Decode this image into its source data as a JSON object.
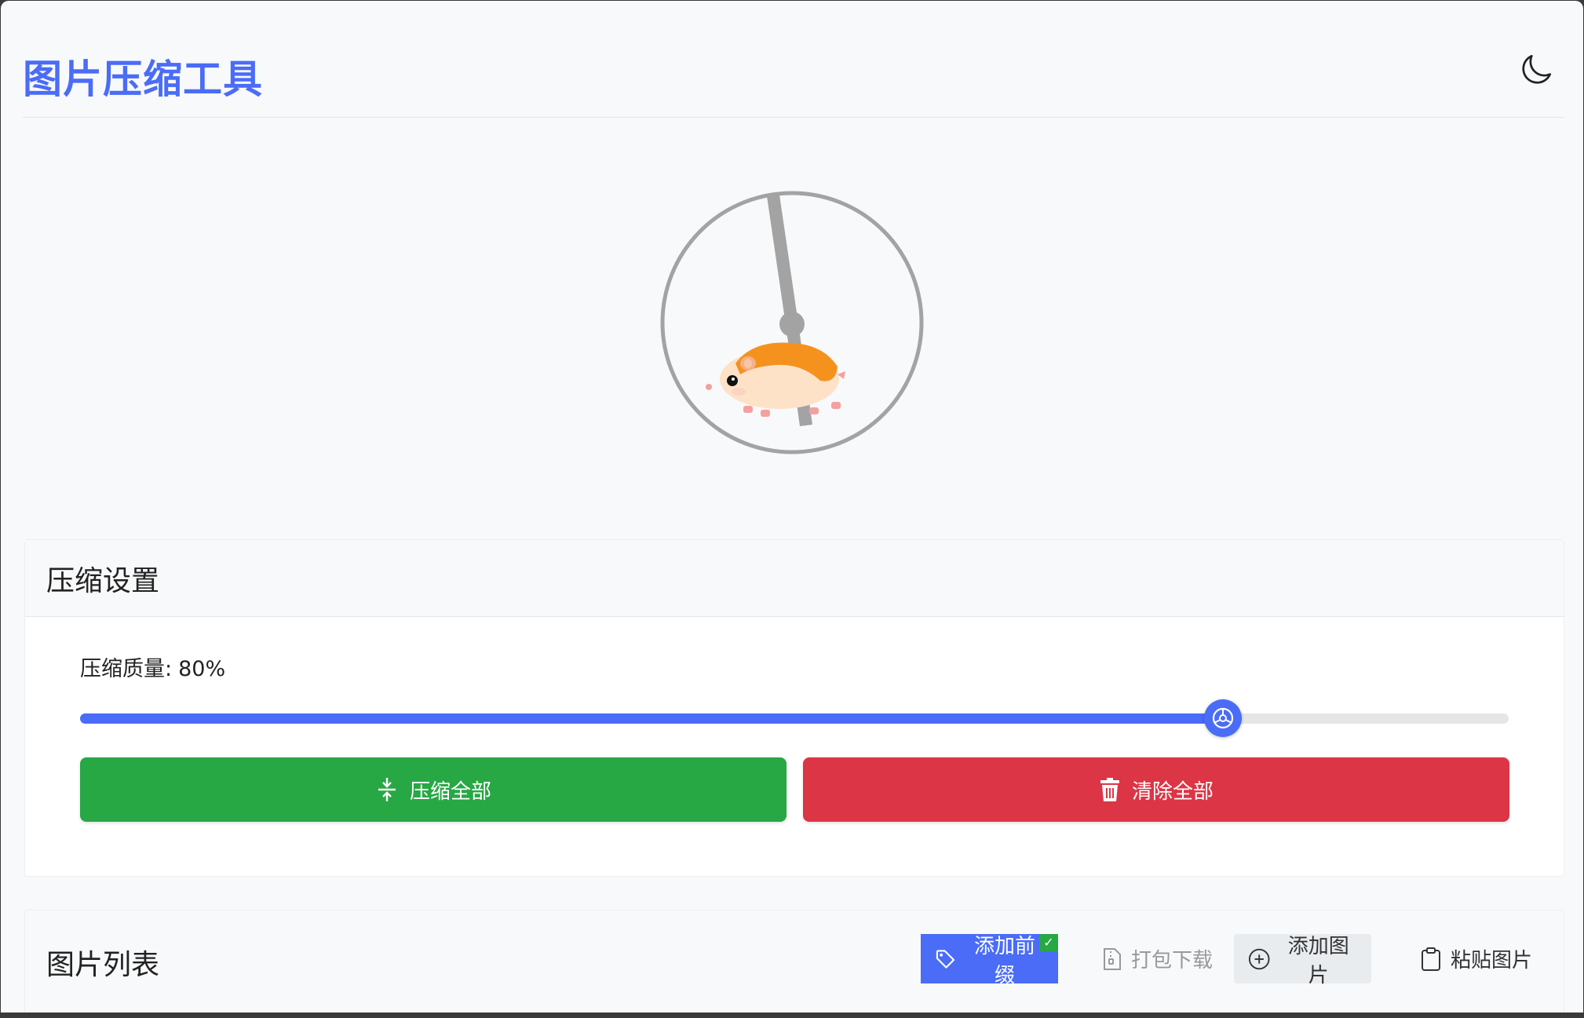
{
  "app": {
    "title": "图片压缩工具"
  },
  "header": {
    "theme_toggle_icon": "moon-icon"
  },
  "loader": {
    "icon": "hamster-wheel"
  },
  "settings": {
    "title": "压缩设置",
    "quality_label": "压缩质量:",
    "quality_value": "80%",
    "quality_percent": 80,
    "slider_thumb_icon": "hamster-ball-icon",
    "compress_all_label": "压缩全部",
    "compress_all_icon": "compress-icon",
    "clear_all_label": "清除全部",
    "clear_all_icon": "trash-icon"
  },
  "image_list": {
    "title": "图片列表",
    "add_prefix_label": "添加前缀",
    "add_prefix_icon": "tag-icon",
    "add_prefix_checked": true,
    "download_zip_label": "打包下载",
    "download_zip_icon": "zip-file-icon",
    "add_image_label": "添加图片",
    "add_image_icon": "plus-circle-icon",
    "paste_image_label": "粘贴图片",
    "paste_image_icon": "clipboard-icon"
  },
  "colors": {
    "accent": "#4a6cf7",
    "success": "#28a745",
    "danger": "#dc3545",
    "background": "#f8f9fa"
  }
}
